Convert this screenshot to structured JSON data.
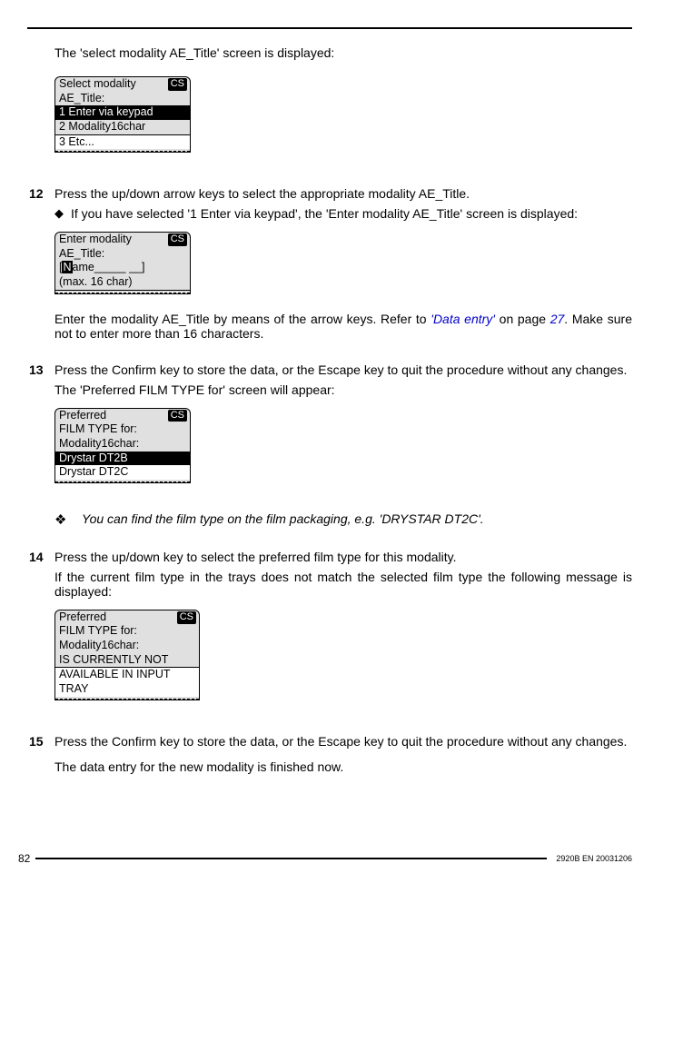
{
  "intro_text": "The 'select modality AE_Title' screen is displayed:",
  "lcd1": {
    "cs": "CS",
    "line1": "Select modality",
    "line2": "AE_Title:",
    "opt1": "1 Enter via keypad",
    "opt2": "2 Modality16char",
    "opt3": "3 Etc..."
  },
  "step12": {
    "num": "12",
    "text": "Press the up/down arrow keys to select the appropriate modality AE_Title.",
    "bullet": "If you have selected '1 Enter via keypad', the 'Enter modality AE_Title' screen is displayed:"
  },
  "lcd2": {
    "cs": "CS",
    "line1": "Enter modality",
    "line2": "AE_Title:",
    "cursor": "N",
    "input_rest": "ame_____ __]",
    "input_prefix": "[",
    "line4": "(max. 16 char)"
  },
  "after_lcd2_p1a": "Enter the modality AE_Title by means of the arrow keys. Refer to ",
  "after_lcd2_link1": "'Data entry'",
  "after_lcd2_p1b": " on page ",
  "after_lcd2_link2": "27",
  "after_lcd2_p1c": ". Make sure not to enter more than 16 characters.",
  "step13": {
    "num": "13",
    "text": "Press the Confirm key to store the data, or the Escape key to quit the procedure without any changes.",
    "text2": "The 'Preferred FILM TYPE for' screen will appear:"
  },
  "lcd3": {
    "cs": "CS",
    "line1": "Preferred",
    "line2": "FILM TYPE for:",
    "line3": "Modality16char:",
    "sel": "Drystar DT2B",
    "line5": "Drystar DT2C"
  },
  "note13": "You can find the film type on the film packaging, e.g. 'DRYSTAR DT2C'.",
  "step14": {
    "num": "14",
    "text": "Press the up/down key to select the preferred film type for this modality.",
    "text2": "If the current film type in the trays does not match the selected film type the following message is displayed:"
  },
  "lcd4": {
    "cs": "CS",
    "line1": "Preferred",
    "line2": "FILM TYPE for:",
    "line3": "Modality16char:",
    "line4": "IS CURRENTLY NOT",
    "line5": "AVAILABLE IN INPUT",
    "line6": "TRAY"
  },
  "step15": {
    "num": "15",
    "text": "Press the Confirm key to store the data, or the Escape key to quit the procedure without any changes.",
    "text2": "The data entry for the new modality is finished now."
  },
  "footer": {
    "page": "82",
    "docid": "2920B EN 20031206"
  }
}
